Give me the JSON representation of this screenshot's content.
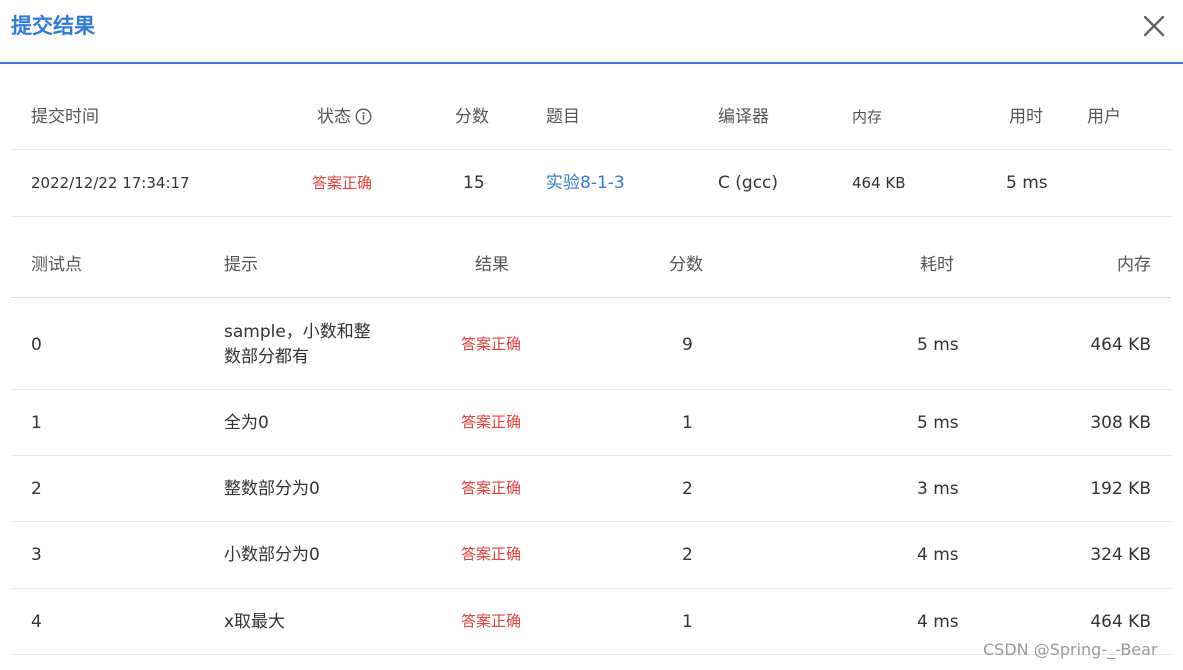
{
  "dialog": {
    "title": "提交结果"
  },
  "summary": {
    "headers": {
      "time": "提交时间",
      "status": "状态",
      "score": "分数",
      "problem": "题目",
      "compiler": "编译器",
      "memory": "内存",
      "duration": "用时",
      "user": "用户"
    },
    "row": {
      "time": "2022/12/22 17:34:17",
      "status": "答案正确",
      "score": "15",
      "problem": "实验8-1-3",
      "compiler": "C (gcc)",
      "memory": "464 KB",
      "duration": "5 ms",
      "user": ""
    }
  },
  "details": {
    "headers": {
      "case": "测试点",
      "hint": "提示",
      "result": "结果",
      "score": "分数",
      "time": "耗时",
      "memory": "内存"
    },
    "rows": [
      {
        "case": "0",
        "hint": "sample，小数和整数部分都有",
        "result": "答案正确",
        "score": "9",
        "time": "5 ms",
        "memory": "464 KB"
      },
      {
        "case": "1",
        "hint": "全为0",
        "result": "答案正确",
        "score": "1",
        "time": "5 ms",
        "memory": "308 KB"
      },
      {
        "case": "2",
        "hint": "整数部分为0",
        "result": "答案正确",
        "score": "2",
        "time": "3 ms",
        "memory": "192 KB"
      },
      {
        "case": "3",
        "hint": "小数部分为0",
        "result": "答案正确",
        "score": "2",
        "time": "4 ms",
        "memory": "324 KB"
      },
      {
        "case": "4",
        "hint": "x取最大",
        "result": "答案正确",
        "score": "1",
        "time": "4 ms",
        "memory": "464 KB"
      }
    ]
  },
  "watermark": "CSDN @Spring-_-Bear",
  "colors": {
    "accent": "#2f7bdf",
    "success_text": "#e5413a"
  },
  "icons": {
    "close": "close-icon",
    "status_info": "info-circle-icon"
  }
}
